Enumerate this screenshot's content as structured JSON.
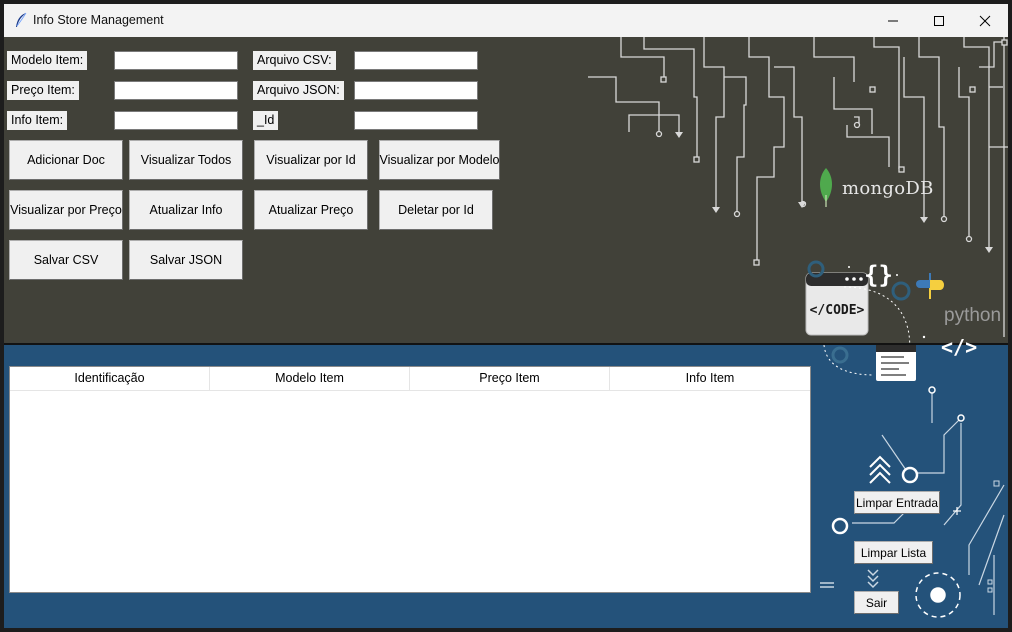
{
  "window": {
    "title": "Info Store Management",
    "icon": "feather-icon"
  },
  "form": {
    "modelo_label": "Modelo Item:",
    "preco_label": "Preço Item:",
    "info_label": "Info Item:",
    "csv_label": "Arquivo CSV:",
    "json_label": "Arquivo JSON:",
    "id_label": "_Id",
    "modelo_value": "",
    "preco_value": "",
    "info_value": "",
    "csv_value": "",
    "json_value": "",
    "id_value": ""
  },
  "buttons": {
    "adicionar": "Adicionar Doc",
    "visualizar_todos": "Visualizar Todos",
    "visualizar_id": "Visualizar por Id",
    "visualizar_modelo": "Visualizar por Modelo",
    "visualizar_preco": "Visualizar por Preço",
    "atualizar_info": "Atualizar Info",
    "atualizar_preco": "Atualizar Preço",
    "deletar_id": "Deletar por Id",
    "salvar_csv": "Salvar CSV",
    "salvar_json": "Salvar JSON",
    "limpar_entrada": "Limpar Entrada",
    "limpar_lista": "Limpar Lista",
    "sair": "Sair"
  },
  "table": {
    "columns": [
      "Identificação",
      "Modelo Item",
      "Preço Item",
      "Info Item"
    ],
    "rows": []
  },
  "decor": {
    "mongodb": "mongoDB",
    "python": "python",
    "code_badge": "</CODE>",
    "braces": "{}",
    "code_tag": "</>"
  },
  "colors": {
    "top_panel": "#414139",
    "bottom_panel": "#24527a",
    "circuit": "#d9d9d9",
    "mongo_green": "#4fa94d",
    "python_blue": "#3d7ab8",
    "python_yellow": "#f5cf3f"
  }
}
